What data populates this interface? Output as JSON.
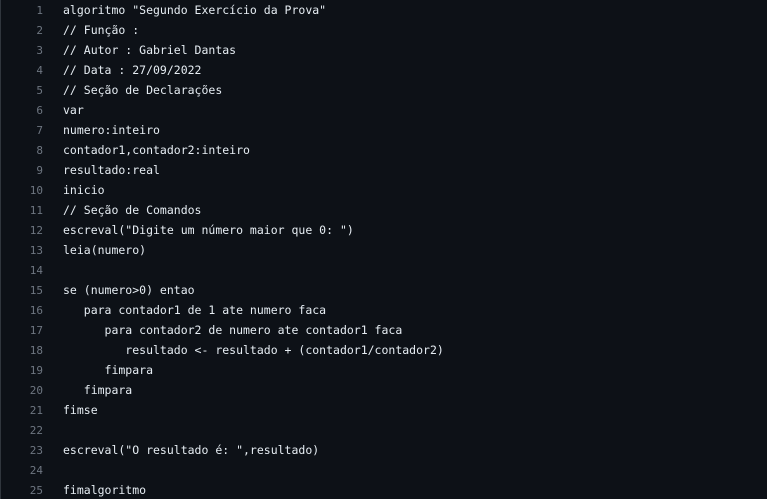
{
  "editor": {
    "lines": [
      {
        "num": "1",
        "text": "algoritmo \"Segundo Exercício da Prova\""
      },
      {
        "num": "2",
        "text": "// Função :"
      },
      {
        "num": "3",
        "text": "// Autor : Gabriel Dantas"
      },
      {
        "num": "4",
        "text": "// Data : 27/09/2022"
      },
      {
        "num": "5",
        "text": "// Seção de Declarações"
      },
      {
        "num": "6",
        "text": "var"
      },
      {
        "num": "7",
        "text": "numero:inteiro"
      },
      {
        "num": "8",
        "text": "contador1,contador2:inteiro"
      },
      {
        "num": "9",
        "text": "resultado:real"
      },
      {
        "num": "10",
        "text": "inicio"
      },
      {
        "num": "11",
        "text": "// Seção de Comandos"
      },
      {
        "num": "12",
        "text": "escreval(\"Digite um número maior que 0: \")"
      },
      {
        "num": "13",
        "text": "leia(numero)"
      },
      {
        "num": "14",
        "text": ""
      },
      {
        "num": "15",
        "text": "se (numero>0) entao"
      },
      {
        "num": "16",
        "text": "   para contador1 de 1 ate numero faca"
      },
      {
        "num": "17",
        "text": "      para contador2 de numero ate contador1 faca"
      },
      {
        "num": "18",
        "text": "         resultado <- resultado + (contador1/contador2)"
      },
      {
        "num": "19",
        "text": "      fimpara"
      },
      {
        "num": "20",
        "text": "   fimpara"
      },
      {
        "num": "21",
        "text": "fimse"
      },
      {
        "num": "22",
        "text": ""
      },
      {
        "num": "23",
        "text": "escreval(\"O resultado é: \",resultado)"
      },
      {
        "num": "24",
        "text": ""
      },
      {
        "num": "25",
        "text": "fimalgoritmo"
      }
    ]
  }
}
